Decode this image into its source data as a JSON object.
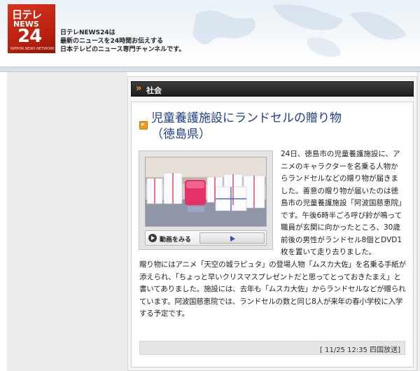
{
  "header": {
    "logo": {
      "line1": "日テレ",
      "line2": "NEWS",
      "line3": "24",
      "line4": "NIPPON NEWS NETWORK"
    },
    "tagline": [
      "日テレNEWS24は",
      "最新のニュースを24時間お伝えする",
      "日本テレビのニュース専門チャンネルです。"
    ]
  },
  "category": {
    "chevron": "»",
    "label": "社会"
  },
  "article": {
    "title_line1": "児童養護施設にランドセルの贈り物",
    "title_line2": "（徳島県）",
    "video_button_label": "動画をみる",
    "body_right": "24日、徳島市の児童養護施設に、アニメのキャラクターを名乗る人物からランドセルなどの贈り物が届きました。善意の贈り物が届いたのは徳島市の児童養護施設「阿波国慈恵院」です。午後6時半ごろ呼び鈴が鳴って職員が玄関に向かったところ、30歳前後の男性がランドセル8個とDVD1枚を置いて走り去りました。",
    "body_full": "贈り物にはアニメ「天空の城ラピュタ」の登場人物「ムスカ大佐」を名乗る手紙が添えられ、「ちょっと早いクリスマスプレゼントだと思ってとっておきたまえ」と書いてありました。施設には、去年も「ムスカ大佐」からランドセルなどが贈られています。阿波国慈恵院では、ランドセルの数と同じ8人が来年の春小学校に入学する予定です。",
    "timestamp": "[ 11/25 12:35 四国放送]"
  },
  "icons": {
    "title_bullet": "arrow-bullet-icon",
    "video": "play-circle-icon",
    "play": "play-triangle-icon"
  },
  "colors": {
    "accent_orange": "#f39a1a",
    "title_blue": "#1f3f8a",
    "logo_red": "#c8260f"
  }
}
